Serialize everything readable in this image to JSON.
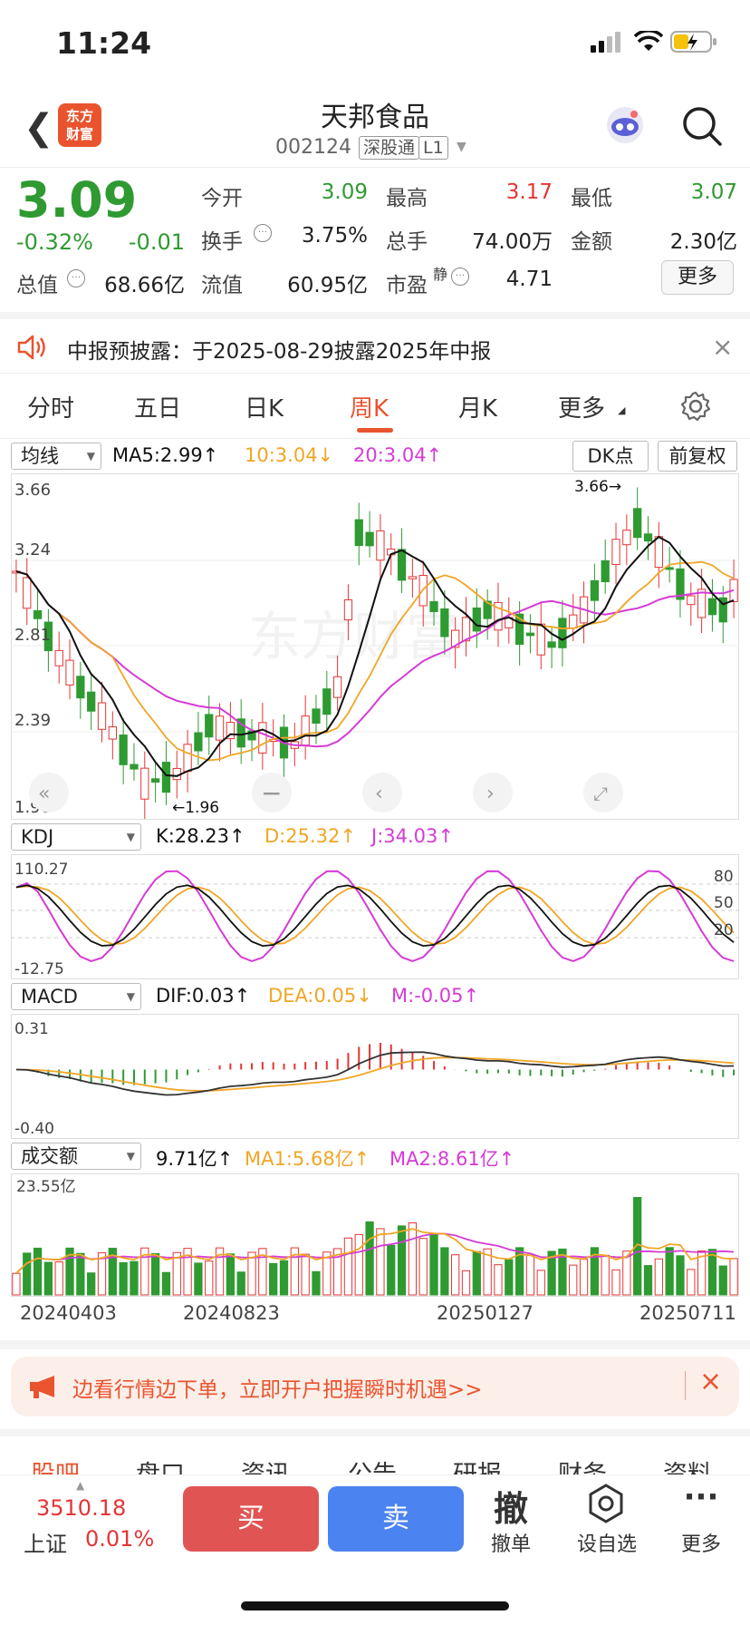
{
  "status": {
    "time": "11:24"
  },
  "nav": {
    "title": "天邦食品",
    "code": "002124",
    "tag_market": "深股通",
    "tag_level": "L1",
    "logo_text_1": "东方",
    "logo_text_2": "财富"
  },
  "quote": {
    "price": "3.09",
    "change_pct": "-0.32%",
    "change": "-0.01",
    "open_label": "今开",
    "open": "3.09",
    "high_label": "最高",
    "high": "3.17",
    "low_label": "最低",
    "low": "3.07",
    "turnover_label": "换手",
    "turnover": "3.75%",
    "volume_label": "总手",
    "volume": "74.00万",
    "amount_label": "金额",
    "amount": "2.30亿",
    "mktcap_label": "总值",
    "mktcap": "68.66亿",
    "float_label": "流值",
    "float_cap": "60.95亿",
    "pe_label": "市盈",
    "pe_sup": "静",
    "pe": "4.71",
    "more": "更多"
  },
  "notice": {
    "text": "中报预披露：于2025-08-29披露2025年中报"
  },
  "tabs": [
    "分时",
    "五日",
    "日K",
    "周K",
    "月K",
    "更多"
  ],
  "ma_row": {
    "selector": "均线",
    "ma5": "MA5:2.99↑",
    "ma10": "10:3.04↓",
    "ma20": "20:3.04↑",
    "dk": "DK点",
    "adjust": "前复权"
  },
  "kline": {
    "y_top": "3.66",
    "y2": "3.24",
    "y3": "2.81",
    "y4": "2.39",
    "y_bottom": "1.96",
    "max_mark": "3.66→",
    "min_mark": "←1.96",
    "watermark": "东方财富"
  },
  "kdj": {
    "selector": "KDJ",
    "k": "K:28.23↑",
    "d": "D:25.32↑",
    "j": "J:34.03↑",
    "top": "110.27",
    "bottom": "-12.75",
    "l80": "80",
    "l50": "50",
    "l20": "20"
  },
  "macd": {
    "selector": "MACD",
    "dif": "DIF:0.03↑",
    "dea": "DEA:0.05↓",
    "m": "M:-0.05↑",
    "top": "0.31",
    "bottom": "-0.40"
  },
  "vol": {
    "selector": "成交额",
    "v": "9.71亿↑",
    "ma1": "MA1:5.68亿↑",
    "ma2": "MA2:8.61亿↑",
    "top": "23.55亿"
  },
  "dates": [
    "20240403",
    "20240823",
    "20250127",
    "20250711"
  ],
  "promo": {
    "text": "边看行情边下单，立即开户把握瞬时机遇>>"
  },
  "bottom_tabs": [
    "股吧",
    "盘口",
    "资讯",
    "公告",
    "研报",
    "财务",
    "资料"
  ],
  "footer": {
    "index_val": "3510.18",
    "index_name": "上证",
    "index_pct": "0.01%",
    "buy": "买",
    "sell": "卖",
    "cancel_icon": "撤",
    "cancel": "撤单",
    "watch": "设自选",
    "more": "更多"
  },
  "colors": {
    "up": "#e53535",
    "down": "#2f9a32",
    "ma5": "#111111",
    "ma10": "#f0a625",
    "ma20": "#d53bd6",
    "accent": "#e9542f"
  }
}
